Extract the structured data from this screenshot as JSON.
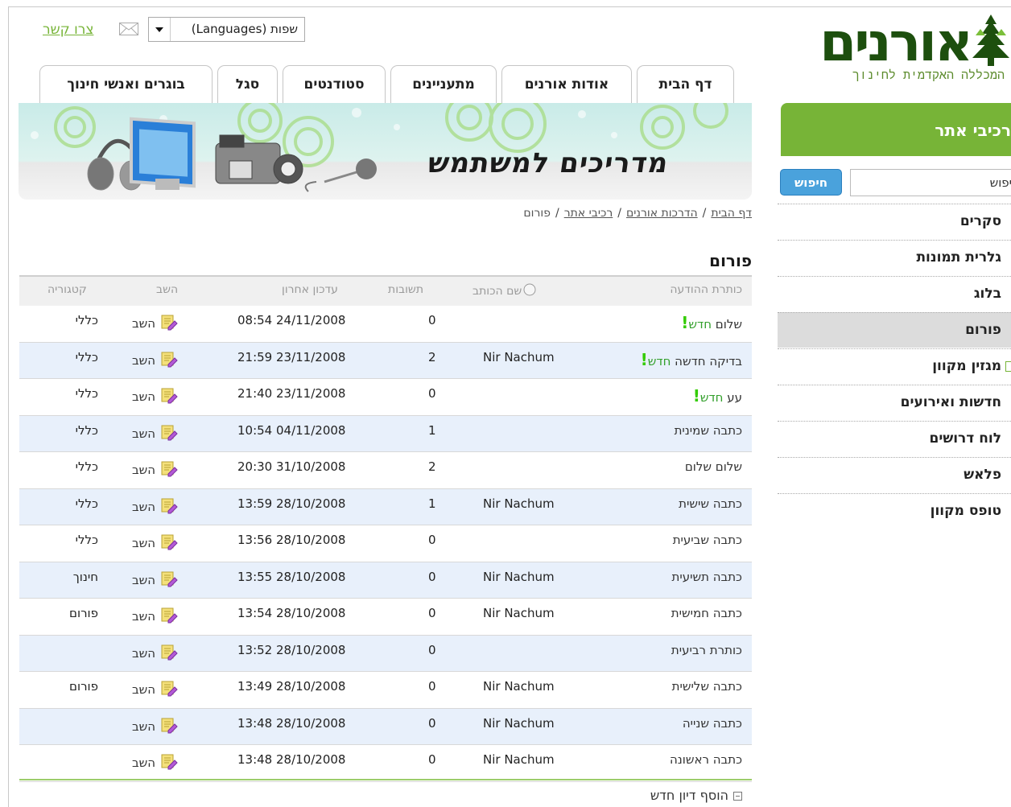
{
  "logo": {
    "name": "אורנים",
    "subtitle": "המכללה האקדמית לחינוך"
  },
  "sidebar": {
    "header": "רכיבי אתר",
    "search_button": "חיפוש",
    "search_value": "יפוש",
    "items": [
      {
        "label": "סקרים"
      },
      {
        "label": "גלרית תמונות"
      },
      {
        "label": "בלוג"
      },
      {
        "label": "פורום"
      },
      {
        "label": "מגזין מקוון"
      },
      {
        "label": "חדשות ואירועים"
      },
      {
        "label": "לוח דרושים"
      },
      {
        "label": "פלאש"
      },
      {
        "label": "טופס מקוון"
      }
    ]
  },
  "top": {
    "language_select": "שפות (Languages)",
    "contact": "צרו קשר"
  },
  "tabs": [
    {
      "label": "דף הבית"
    },
    {
      "label": "אודות אורנים"
    },
    {
      "label": "מתעניינים"
    },
    {
      "label": "סטודנטים"
    },
    {
      "label": "סגל"
    },
    {
      "label": "בוגרים ואנשי חינוך"
    }
  ],
  "banner": {
    "title": "מדריכים למשתמש"
  },
  "breadcrumb": {
    "home": "דף הבית",
    "guides": "הדרכות אורנים",
    "components": "רכיבי אתר",
    "current": "פורום",
    "sep": "/"
  },
  "forum": {
    "title": "פורום",
    "columns": {
      "title": "כותרת ההודעה",
      "author": "שם הכותב",
      "replies": "תשובות",
      "last_update": "עדכון אחרון",
      "reply": "השב",
      "category": "קטגוריה"
    },
    "new_label": "חדש",
    "rows": [
      {
        "title": "שלום",
        "is_new": true,
        "author": "",
        "replies": "0",
        "date": "08:54 24/11/2008",
        "reply": "השב",
        "category": "כללי"
      },
      {
        "title": "בדיקה חדשה",
        "is_new": true,
        "author": "Nir Nachum",
        "replies": "2",
        "date": "21:59 23/11/2008",
        "reply": "השב",
        "category": "כללי"
      },
      {
        "title": "עע",
        "is_new": true,
        "author": "",
        "replies": "0",
        "date": "21:40 23/11/2008",
        "reply": "השב",
        "category": "כללי"
      },
      {
        "title": "כתבה שמינית",
        "is_new": false,
        "author": "",
        "replies": "1",
        "date": "10:54 04/11/2008",
        "reply": "השב",
        "category": "כללי"
      },
      {
        "title": "שלום שלום",
        "is_new": false,
        "author": "",
        "replies": "2",
        "date": "20:30 31/10/2008",
        "reply": "השב",
        "category": "כללי"
      },
      {
        "title": "כתבה שישית",
        "is_new": false,
        "author": "Nir Nachum",
        "replies": "1",
        "date": "13:59 28/10/2008",
        "reply": "השב",
        "category": "כללי"
      },
      {
        "title": "כתבה שביעית",
        "is_new": false,
        "author": "",
        "replies": "0",
        "date": "13:56 28/10/2008",
        "reply": "השב",
        "category": "כללי"
      },
      {
        "title": "כתבה תשיעית",
        "is_new": false,
        "author": "Nir Nachum",
        "replies": "0",
        "date": "13:55 28/10/2008",
        "reply": "השב",
        "category": "חינוך"
      },
      {
        "title": "כתבה חמישית",
        "is_new": false,
        "author": "Nir Nachum",
        "replies": "0",
        "date": "13:54 28/10/2008",
        "reply": "השב",
        "category": "פורום"
      },
      {
        "title": "כותרת רביעית",
        "is_new": false,
        "author": "",
        "replies": "0",
        "date": "13:52 28/10/2008",
        "reply": "השב",
        "category": ""
      },
      {
        "title": "כתבה שלישית",
        "is_new": false,
        "author": "Nir Nachum",
        "replies": "0",
        "date": "13:49 28/10/2008",
        "reply": "השב",
        "category": "פורום"
      },
      {
        "title": "כתבה שנייה",
        "is_new": false,
        "author": "Nir Nachum",
        "replies": "0",
        "date": "13:48 28/10/2008",
        "reply": "השב",
        "category": ""
      },
      {
        "title": "כתבה ראשונה",
        "is_new": false,
        "author": "Nir Nachum",
        "replies": "0",
        "date": "13:48 28/10/2008",
        "reply": "השב",
        "category": ""
      }
    ],
    "add_topic": "הוסף דיון חדש"
  },
  "colors": {
    "green": "#77b437",
    "dark_green": "#1d4f0e",
    "blue_button": "#4aa2dc",
    "row_alt": "#e8f0fb"
  }
}
